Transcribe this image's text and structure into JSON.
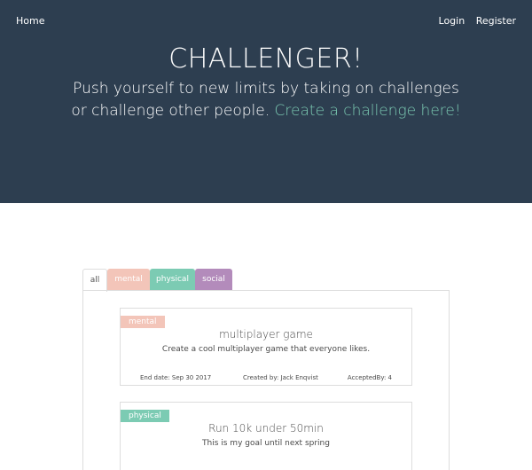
{
  "nav": {
    "home": "Home",
    "login": "Login",
    "register": "Register"
  },
  "hero": {
    "title": "CHALLENGER!",
    "subtitle": "Push yourself to new limits by taking on challenges or challenge other people.",
    "cta": "Create a challenge here!",
    "background": "#2d3e50",
    "cta_color": "#7ccbb3"
  },
  "tabs": [
    {
      "label": "all",
      "color": "#ffffff"
    },
    {
      "label": "mental",
      "color": "#f3c5b9"
    },
    {
      "label": "physical",
      "color": "#7ccbb3"
    },
    {
      "label": "social",
      "color": "#b38bbb"
    }
  ],
  "challenges": [
    {
      "category": "mental",
      "title": "multiplayer game",
      "description": "Create a cool multiplayer game that everyone likes.",
      "end_date": "End date: Sep 30 2017",
      "created_by": "Created by: Jack Enqvist",
      "accepted_by": "AcceptedBy: 4"
    },
    {
      "category": "physical",
      "title": "Run 10k under 50min",
      "description": "This is my goal until next spring"
    }
  ]
}
